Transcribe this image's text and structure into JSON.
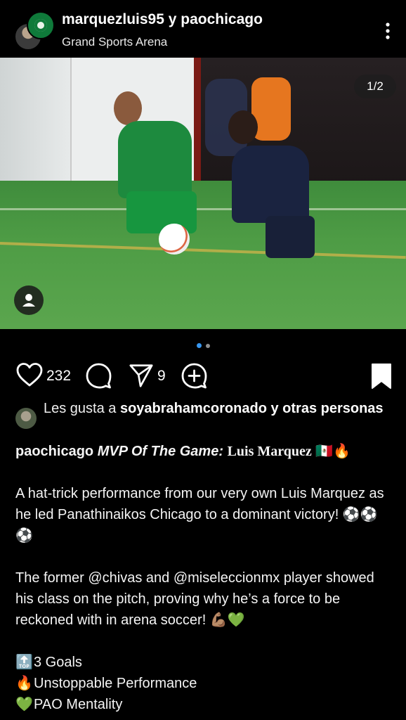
{
  "post": {
    "author": "marquezluis95 y paochicago",
    "location": "Grand Sports Arena",
    "image_counter": "1/2",
    "carousel": {
      "total": 2,
      "active_index": 0
    }
  },
  "actions": {
    "likes_count": "232",
    "shares_count": "9"
  },
  "likes_text": {
    "prefix": "Les gusta a ",
    "user": "soyabrahamcoronado",
    "suffix": " y otras personas"
  },
  "caption": {
    "username": "paochicago",
    "mvp_label": "MVP Of The Game",
    "mvp_colon": ": ",
    "mvp_name": "Luis Marquez",
    "mvp_emoji": " 🇲🇽🔥",
    "paragraph1": "A hat-trick performance from our very own Luis Marquez as he led Panathinaikos Chicago to a dominant victory! ⚽⚽⚽",
    "paragraph2": "The former @chivas and @miseleccionmx player showed his class on the pitch, proving why he’s a force to be reckoned with in arena soccer! 💪🏽💚",
    "list": [
      {
        "icon": "🔝",
        "text": "3 Goals"
      },
      {
        "icon": "🔥",
        "text": "Unstoppable Performance"
      },
      {
        "icon": "💚",
        "text": "PAO Mentality"
      }
    ]
  },
  "colors": {
    "background": "#000000",
    "text": "#ffffff",
    "dot_active": "#3897f0",
    "dot_inactive": "#8e8e8e"
  }
}
